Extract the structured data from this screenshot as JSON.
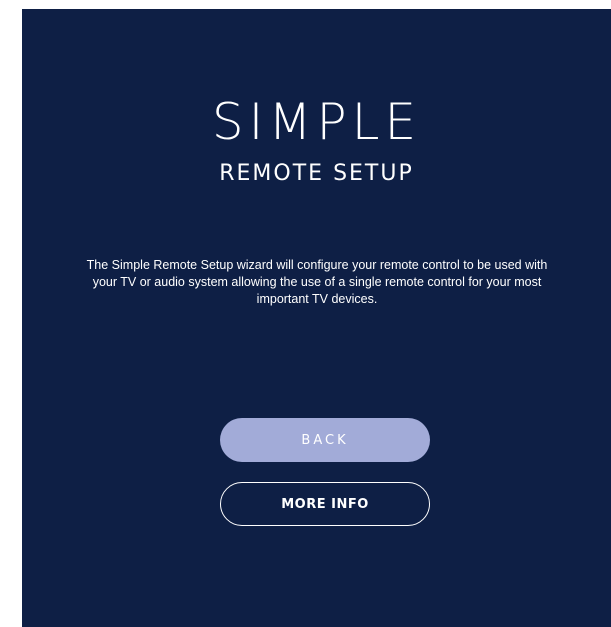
{
  "title": {
    "main": "SIMPLE",
    "sub": "REMOTE SETUP"
  },
  "description": "The Simple Remote Setup wizard will configure your remote control to be used with your TV or audio system allowing the use of a single remote control for your most important TV devices.",
  "buttons": {
    "back_label": "BACK",
    "more_info_label": "MORE INFO"
  },
  "colors": {
    "background": "#0e1f45",
    "back_button": "#a2abd8",
    "text": "#ffffff"
  }
}
